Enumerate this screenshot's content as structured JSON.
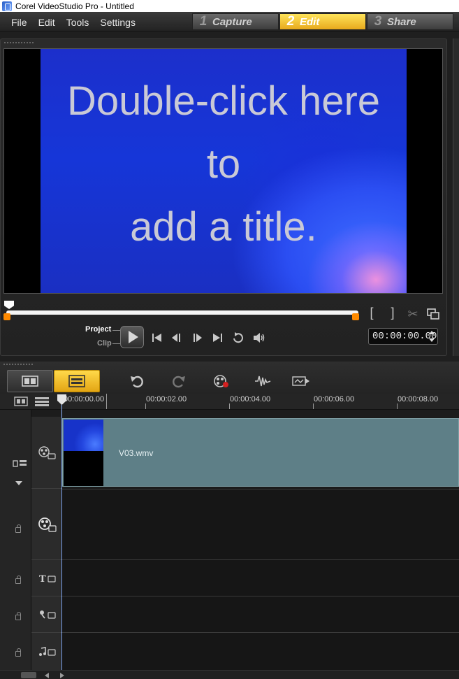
{
  "window": {
    "title": "Corel VideoStudio Pro - Untitled"
  },
  "menu": [
    "File",
    "Edit",
    "Tools",
    "Settings"
  ],
  "steps": [
    {
      "num": "1",
      "label": "Capture"
    },
    {
      "num": "2",
      "label": "Edit",
      "active": true
    },
    {
      "num": "3",
      "label": "Share"
    }
  ],
  "preview": {
    "overlay_text": "Double-click here\nto\nadd a title.",
    "mode_project": "Project",
    "mode_clip": "Clip",
    "timecode": "00:00:00.00",
    "mark_in": "[",
    "mark_out": "]"
  },
  "ruler": {
    "start": "00:00:00.00",
    "labels": [
      "00:00:02.00",
      "00:00:04.00",
      "00:00:06.00",
      "00:00:08.00"
    ]
  },
  "track_add_label": "+/−",
  "clip": {
    "name": "V03.wmv"
  },
  "colors": {
    "accent": "#f2c12e",
    "clip": "#5e7f87",
    "trim": "#ff8a00"
  }
}
